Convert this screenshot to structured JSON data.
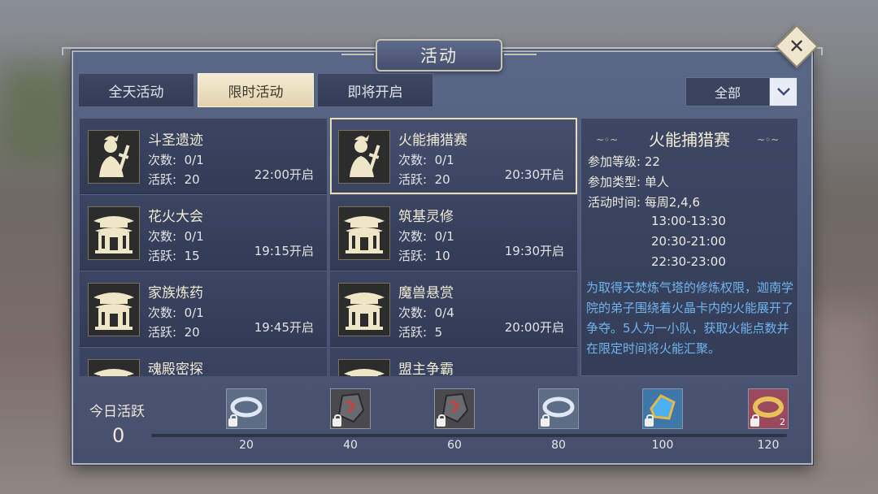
{
  "window": {
    "title": "活动",
    "close_icon": "close-icon"
  },
  "tabs": [
    {
      "label": "全天活动",
      "active": false
    },
    {
      "label": "限时活动",
      "active": true
    },
    {
      "label": "即将开启",
      "active": false
    }
  ],
  "filter": {
    "selected": "全部"
  },
  "activities": [
    {
      "name": "斗圣遗迹",
      "count_label": "次数:",
      "count": "0/1",
      "active_label": "活跃:",
      "active": "20",
      "time": "22:00开启",
      "icon": "warrior-icon",
      "selected": false
    },
    {
      "name": "火能捕猎赛",
      "count_label": "次数:",
      "count": "0/1",
      "active_label": "活跃:",
      "active": "20",
      "time": "20:30开启",
      "icon": "warrior-icon",
      "selected": true
    },
    {
      "name": "花火大会",
      "count_label": "次数:",
      "count": "0/1",
      "active_label": "活跃:",
      "active": "15",
      "time": "19:15开启",
      "icon": "pagoda-icon",
      "selected": false
    },
    {
      "name": "筑基灵修",
      "count_label": "次数:",
      "count": "0/1",
      "active_label": "活跃:",
      "active": "10",
      "time": "19:30开启",
      "icon": "pagoda-icon",
      "selected": false
    },
    {
      "name": "家族炼药",
      "count_label": "次数:",
      "count": "0/1",
      "active_label": "活跃:",
      "active": "20",
      "time": "19:45开启",
      "icon": "pagoda-icon",
      "selected": false
    },
    {
      "name": "魔兽悬赏",
      "count_label": "次数:",
      "count": "0/4",
      "active_label": "活跃:",
      "active": "5",
      "time": "20:00开启",
      "icon": "pagoda-icon",
      "selected": false
    },
    {
      "name": "魂殿密探",
      "count_label": "",
      "count": "",
      "active_label": "",
      "active": "",
      "time": "",
      "icon": "pagoda-icon",
      "selected": false
    },
    {
      "name": "盟主争霸",
      "count_label": "",
      "count": "",
      "active_label": "",
      "active": "",
      "time": "",
      "icon": "pagoda-icon",
      "selected": false
    }
  ],
  "detail": {
    "title": "火能捕猎赛",
    "level_label": "参加等级:",
    "level": "22",
    "type_label": "参加类型:",
    "type": "单人",
    "time_label": "活动时间:",
    "days": "每周2,4,6",
    "slots": [
      "13:00-13:30",
      "20:30-21:00",
      "22:30-23:00"
    ],
    "description": "为取得天焚炼气塔的修炼权限，迦南学院的弟子围绕着火晶卡内的火能展开了争夺。5人为一小队，获取火能点数并在限定时间将火能汇聚。"
  },
  "progress": {
    "label": "今日活跃",
    "value": "0",
    "fill_fraction": 0,
    "rewards": [
      {
        "milestone": "20",
        "icon": "silver-ring-icon",
        "locked": true,
        "count": "",
        "color": "#5d6d86"
      },
      {
        "milestone": "40",
        "icon": "ore-stone-icon",
        "locked": true,
        "count": "",
        "color": "#4a4a4c"
      },
      {
        "milestone": "60",
        "icon": "ore-stone-icon",
        "locked": true,
        "count": "",
        "color": "#4a4a4c"
      },
      {
        "milestone": "80",
        "icon": "silver-ring-icon",
        "locked": true,
        "count": "",
        "color": "#5d6d86"
      },
      {
        "milestone": "100",
        "icon": "blue-gem-icon",
        "locked": true,
        "count": "",
        "color": "#3e78a8"
      },
      {
        "milestone": "120",
        "icon": "gold-ring-icon",
        "locked": true,
        "count": "2",
        "color": "#9a4a5c"
      }
    ]
  },
  "colors": {
    "accent": "#e8dcb4",
    "description": "#6fb3ef",
    "panel": "#4c5878"
  }
}
